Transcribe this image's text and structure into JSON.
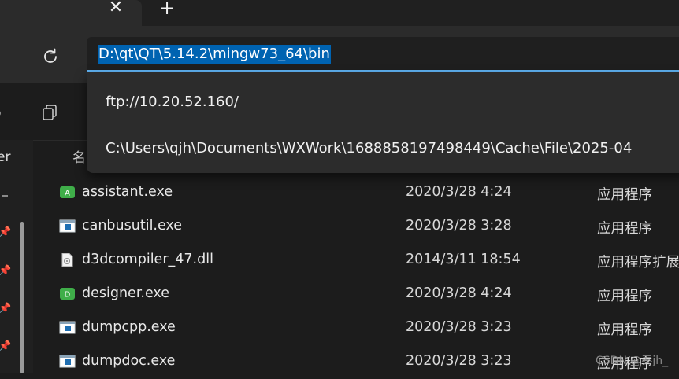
{
  "tabs": {
    "close_symbol": "✕",
    "new_tab_symbol": "+"
  },
  "address_bar": {
    "value": "D:\\qt\\QT\\5.14.2\\mingw73_64\\bin",
    "selection_color": "#0063b1",
    "focus_color": "#5fb2f2"
  },
  "suggestions": [
    "ftp://10.20.52.160/",
    "C:\\Users\\qjh\\Documents\\WXWork\\1688858197498449\\Cache\\File\\2025-04"
  ],
  "nav_pane": {
    "partial_label": "er"
  },
  "file_list": {
    "name_header_partial": "名",
    "files": [
      {
        "name": "assistant.exe",
        "date": "2020/3/28 4:24",
        "type": "应用程序",
        "icon": "assistant-exe-icon",
        "icon_letter": "A"
      },
      {
        "name": "canbusutil.exe",
        "date": "2020/3/28 3:28",
        "type": "应用程序",
        "icon": "app-window-icon",
        "icon_letter": ""
      },
      {
        "name": "d3dcompiler_47.dll",
        "date": "2014/3/11 18:54",
        "type": "应用程序扩展",
        "icon": "dll-file-icon",
        "icon_letter": ""
      },
      {
        "name": "designer.exe",
        "date": "2020/3/28 4:24",
        "type": "应用程序",
        "icon": "designer-exe-icon",
        "icon_letter": "D"
      },
      {
        "name": "dumpcpp.exe",
        "date": "2020/3/28 3:23",
        "type": "应用程序",
        "icon": "app-window-icon",
        "icon_letter": ""
      },
      {
        "name": "dumpdoc.exe",
        "date": "2020/3/28 3:23",
        "type": "应用程序",
        "icon": "app-window-icon",
        "icon_letter": ""
      }
    ]
  },
  "watermark": "CSDN @秦jh_"
}
